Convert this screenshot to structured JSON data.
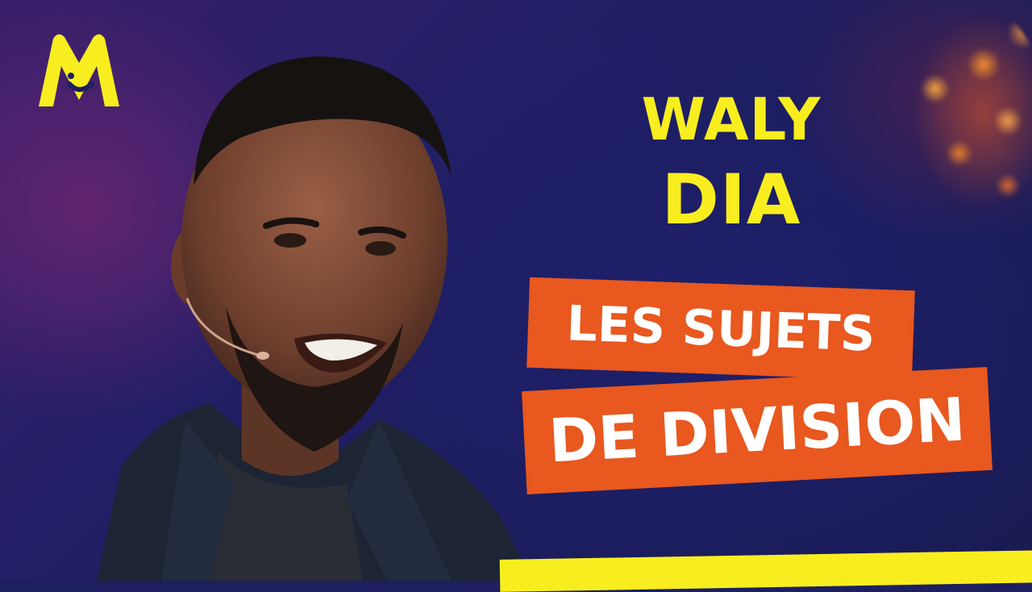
{
  "headline": {
    "line1": "WALY",
    "line2": "DIA"
  },
  "banner": {
    "line1": "LES SUJETS",
    "line2": "DE DIVISION"
  },
  "logo": {
    "icon": "montreux-comedy-logo-icon"
  },
  "colors": {
    "accent_yellow": "#f8ee1f",
    "banner_orange": "#e8581f",
    "background_navy": "#1d1f5e"
  }
}
